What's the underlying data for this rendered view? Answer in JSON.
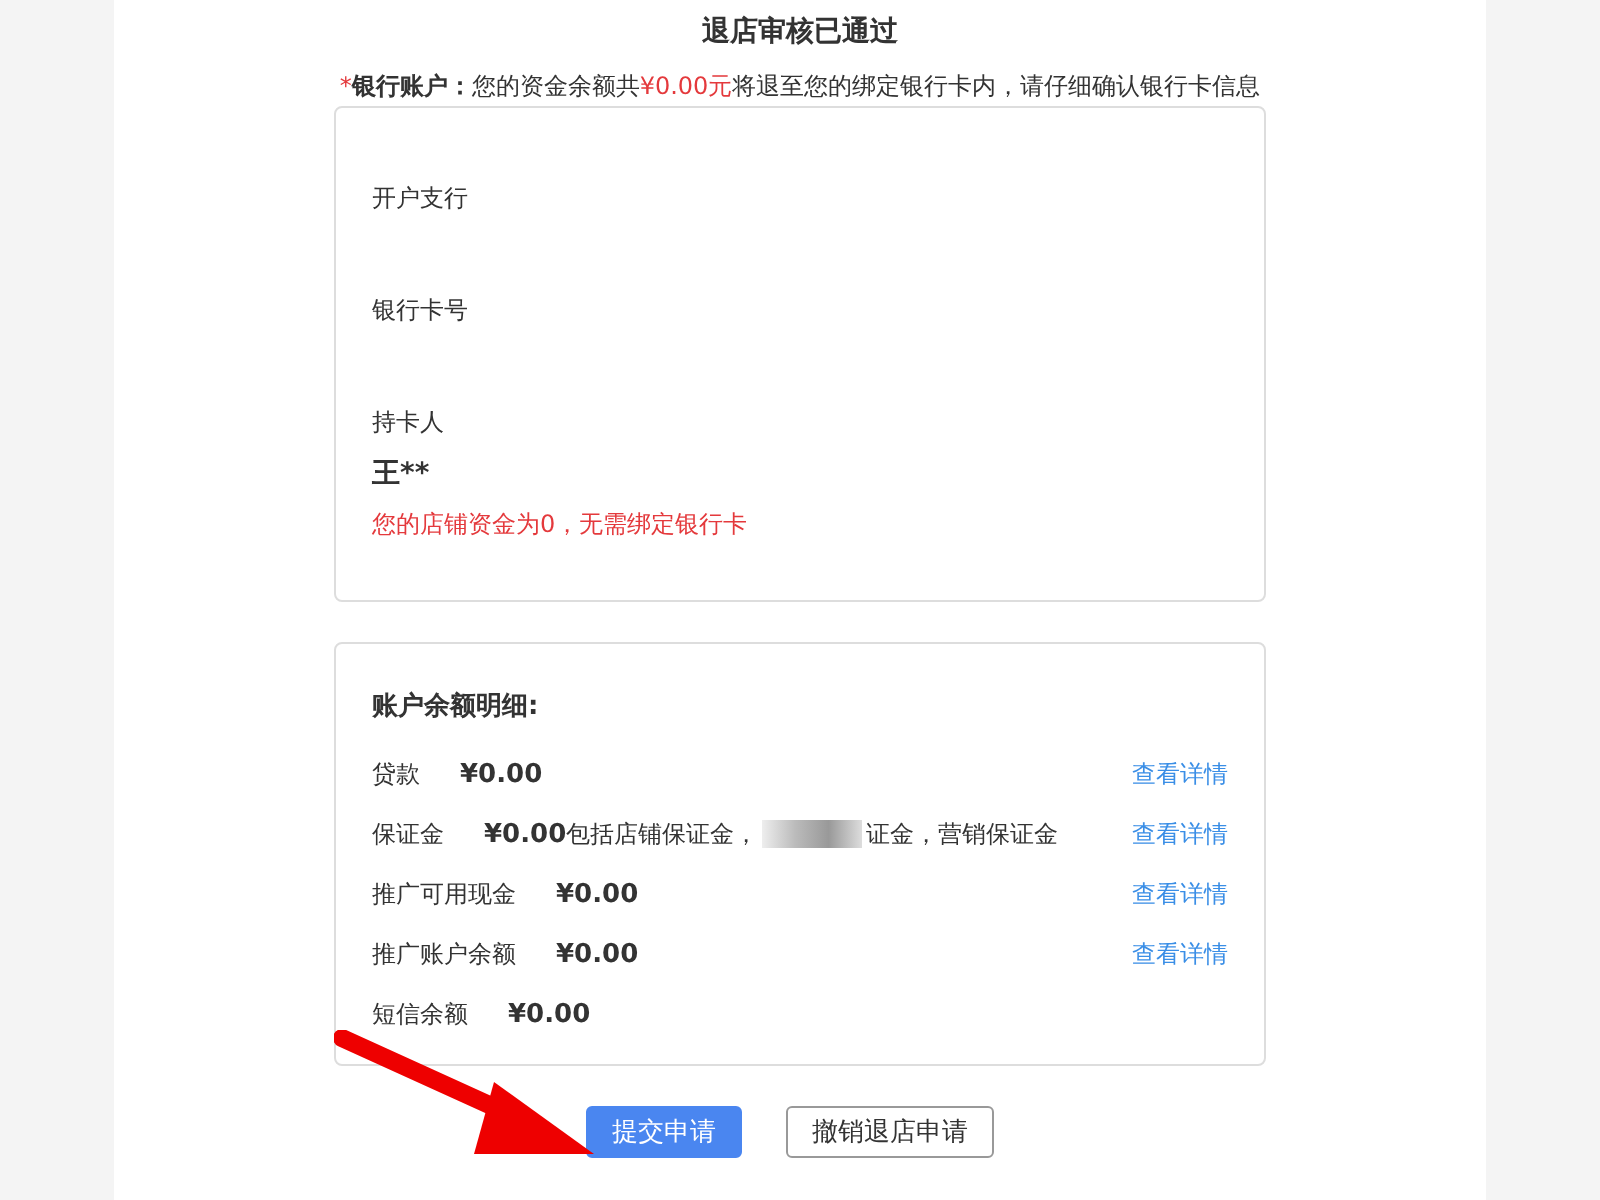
{
  "title": "退店审核已通过",
  "notice": {
    "mark": "*",
    "label": "银行账户：",
    "before": "您的资金余额共",
    "amount": "¥0.00元",
    "after": "将退至您的绑定银行卡内，请仔细确认银行卡信息"
  },
  "bank_fields": [
    {
      "label": "开户支行"
    },
    {
      "label": "银行卡号"
    },
    {
      "label": "持卡人",
      "value": "王**"
    }
  ],
  "bank_note": "您的店铺资金为0，无需绑定银行卡",
  "balance": {
    "heading": "账户余额明细:",
    "rows": [
      {
        "label": "贷款",
        "amount": "¥0.00",
        "link": "查看详情"
      },
      {
        "label": "保证金",
        "amount": "¥0.00",
        "note_before": "包括店铺保证金，",
        "note_after": "证金，营销保证金",
        "link": "查看详情"
      },
      {
        "label": "推广可用现金",
        "amount": "¥0.00",
        "link": "查看详情"
      },
      {
        "label": "推广账户余额",
        "amount": "¥0.00",
        "link": "查看详情"
      },
      {
        "label": "短信余额",
        "amount": "¥0.00"
      }
    ]
  },
  "buttons": [
    {
      "label": "提交申请",
      "kind": "primary"
    },
    {
      "label": "撤销退店申请",
      "kind": "default"
    }
  ]
}
